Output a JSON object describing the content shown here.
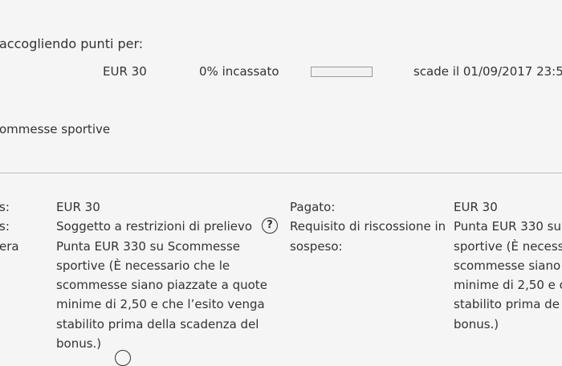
{
  "bonus": {
    "heading": "accogliendo punti per:",
    "amount": "EUR 30",
    "progress_text": "0% incassato",
    "progress_value": 0,
    "expiry": "scade il 01/09/2017 23:5",
    "category": "ommesse sportive"
  },
  "details": {
    "left_labels": [
      "s:",
      "s:",
      "era"
    ],
    "left_values": [
      "EUR 30",
      "Soggetto a restrizioni di prelievo",
      "Punta EUR 330 su Scommesse",
      "sportive (È necessario che le",
      "scommesse siano piazzate a quote",
      "minime di 2,50 e che l’esito venga",
      "stabilito prima della scadenza del",
      "bonus.)"
    ],
    "mid_labels": [
      "Pagato:",
      "Requisito di riscossione in",
      "sospeso:"
    ],
    "right_values": [
      "EUR 30",
      "Punta EUR 330 su",
      "sportive (È necess",
      "scommesse siano",
      "minime di 2,50 e c",
      "stabilito prima de",
      "bonus.)"
    ],
    "help_icon_glyph": "?"
  },
  "colors": {
    "text": "#333333",
    "background": "#f5f5f5",
    "divider": "#bdbdbd"
  }
}
